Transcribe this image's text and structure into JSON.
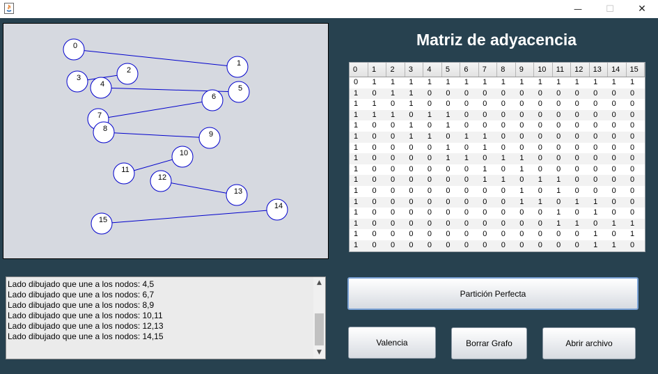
{
  "window": {
    "app_icon": "java-icon",
    "minimize_glyph": "—",
    "maximize_glyph": "☐",
    "close_glyph": "✕"
  },
  "matrix": {
    "title": "Matriz de adyacencia",
    "headers": [
      "0",
      "1",
      "2",
      "3",
      "4",
      "5",
      "6",
      "7",
      "8",
      "9",
      "10",
      "11",
      "12",
      "13",
      "14",
      "15"
    ],
    "rows": [
      [
        "0",
        "1",
        "1",
        "1",
        "1",
        "1",
        "1",
        "1",
        "1",
        "1",
        "1",
        "1",
        "1",
        "1",
        "1",
        "1"
      ],
      [
        "1",
        "0",
        "1",
        "1",
        "0",
        "0",
        "0",
        "0",
        "0",
        "0",
        "0",
        "0",
        "0",
        "0",
        "0",
        "0"
      ],
      [
        "1",
        "1",
        "0",
        "1",
        "0",
        "0",
        "0",
        "0",
        "0",
        "0",
        "0",
        "0",
        "0",
        "0",
        "0",
        "0"
      ],
      [
        "1",
        "1",
        "1",
        "0",
        "1",
        "1",
        "0",
        "0",
        "0",
        "0",
        "0",
        "0",
        "0",
        "0",
        "0",
        "0"
      ],
      [
        "1",
        "0",
        "0",
        "1",
        "0",
        "1",
        "0",
        "0",
        "0",
        "0",
        "0",
        "0",
        "0",
        "0",
        "0",
        "0"
      ],
      [
        "1",
        "0",
        "0",
        "1",
        "1",
        "0",
        "1",
        "1",
        "0",
        "0",
        "0",
        "0",
        "0",
        "0",
        "0",
        "0"
      ],
      [
        "1",
        "0",
        "0",
        "0",
        "0",
        "1",
        "0",
        "1",
        "0",
        "0",
        "0",
        "0",
        "0",
        "0",
        "0",
        "0"
      ],
      [
        "1",
        "0",
        "0",
        "0",
        "0",
        "1",
        "1",
        "0",
        "1",
        "1",
        "0",
        "0",
        "0",
        "0",
        "0",
        "0"
      ],
      [
        "1",
        "0",
        "0",
        "0",
        "0",
        "0",
        "0",
        "1",
        "0",
        "1",
        "0",
        "0",
        "0",
        "0",
        "0",
        "0"
      ],
      [
        "1",
        "0",
        "0",
        "0",
        "0",
        "0",
        "0",
        "1",
        "1",
        "0",
        "1",
        "1",
        "0",
        "0",
        "0",
        "0"
      ],
      [
        "1",
        "0",
        "0",
        "0",
        "0",
        "0",
        "0",
        "0",
        "0",
        "1",
        "0",
        "1",
        "0",
        "0",
        "0",
        "0"
      ],
      [
        "1",
        "0",
        "0",
        "0",
        "0",
        "0",
        "0",
        "0",
        "0",
        "1",
        "1",
        "0",
        "1",
        "1",
        "0",
        "0"
      ],
      [
        "1",
        "0",
        "0",
        "0",
        "0",
        "0",
        "0",
        "0",
        "0",
        "0",
        "0",
        "1",
        "0",
        "1",
        "0",
        "0"
      ],
      [
        "1",
        "0",
        "0",
        "0",
        "0",
        "0",
        "0",
        "0",
        "0",
        "0",
        "0",
        "1",
        "1",
        "0",
        "1",
        "1"
      ],
      [
        "1",
        "0",
        "0",
        "0",
        "0",
        "0",
        "0",
        "0",
        "0",
        "0",
        "0",
        "0",
        "0",
        "1",
        "0",
        "1"
      ],
      [
        "1",
        "0",
        "0",
        "0",
        "0",
        "0",
        "0",
        "0",
        "0",
        "0",
        "0",
        "0",
        "0",
        "1",
        "1",
        "0"
      ]
    ]
  },
  "graph": {
    "edge_color": "#0000cc",
    "node_labels": [
      "0",
      "1",
      "2",
      "3",
      "4",
      "5",
      "6",
      "7",
      "8",
      "9",
      "10",
      "11",
      "12",
      "13",
      "14",
      "15"
    ],
    "edges_drawn": [
      [
        "0",
        "1"
      ],
      [
        "2",
        "3"
      ],
      [
        "4",
        "5"
      ],
      [
        "6",
        "7"
      ],
      [
        "8",
        "9"
      ],
      [
        "10",
        "11"
      ],
      [
        "12",
        "13"
      ],
      [
        "14",
        "15"
      ]
    ]
  },
  "log": {
    "lines": [
      "Lado dibujado que une a los nodos: 4,5",
      "Lado dibujado que une a los nodos: 6,7",
      "Lado dibujado que une a los nodos: 8,9",
      "Lado dibujado que une a los nodos: 10,11",
      "Lado dibujado que une a los nodos: 12,13",
      "Lado dibujado que une a los nodos: 14,15"
    ],
    "scroll_up_glyph": "▲",
    "scroll_down_glyph": "▼"
  },
  "buttons": {
    "particion": "Partición Perfecta",
    "valencia": "Valencia",
    "borrar": "Borrar Grafo",
    "abrir": "Abrir archivo"
  },
  "colors": {
    "background": "#27414f",
    "canvas": "#d6d9e0",
    "edge": "#0000cc",
    "node_fill": "#ffffff"
  }
}
